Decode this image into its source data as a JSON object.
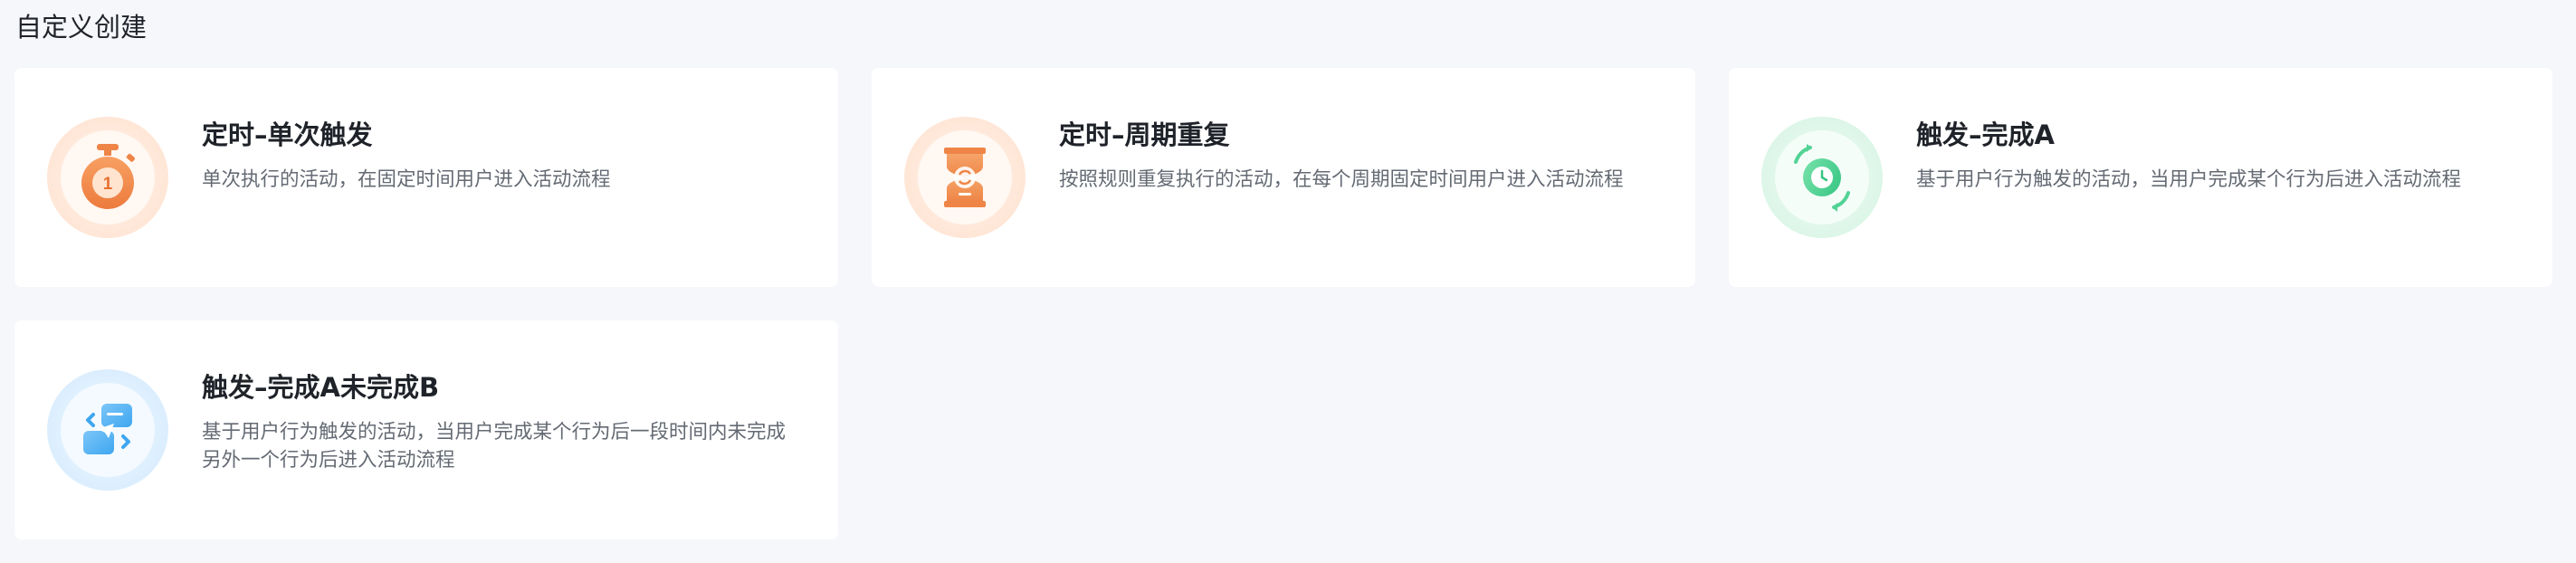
{
  "section": {
    "title": "自定义创建"
  },
  "cards": [
    {
      "title": "定时–单次触发",
      "description": "单次执行的活动，在固定时间用户进入活动流程",
      "icon": "stopwatch-icon",
      "accent": "#f08a4b"
    },
    {
      "title": "定时–周期重复",
      "description": "按照规则重复执行的活动，在每个周期固定时间用户进入活动流程",
      "icon": "hourglass-icon",
      "accent": "#f29a5a"
    },
    {
      "title": "触发–完成A",
      "description": "基于用户行为触发的活动，当用户完成某个行为后进入活动流程",
      "icon": "clock-cycle-icon",
      "accent": "#3fcf8e"
    },
    {
      "title": "触发–完成A未完成B",
      "description": "基于用户行为触发的活动，当用户完成某个行为后一段时间内未完成另外一个行为后进入活动流程",
      "icon": "message-swap-icon",
      "accent": "#3ea6f0"
    }
  ]
}
